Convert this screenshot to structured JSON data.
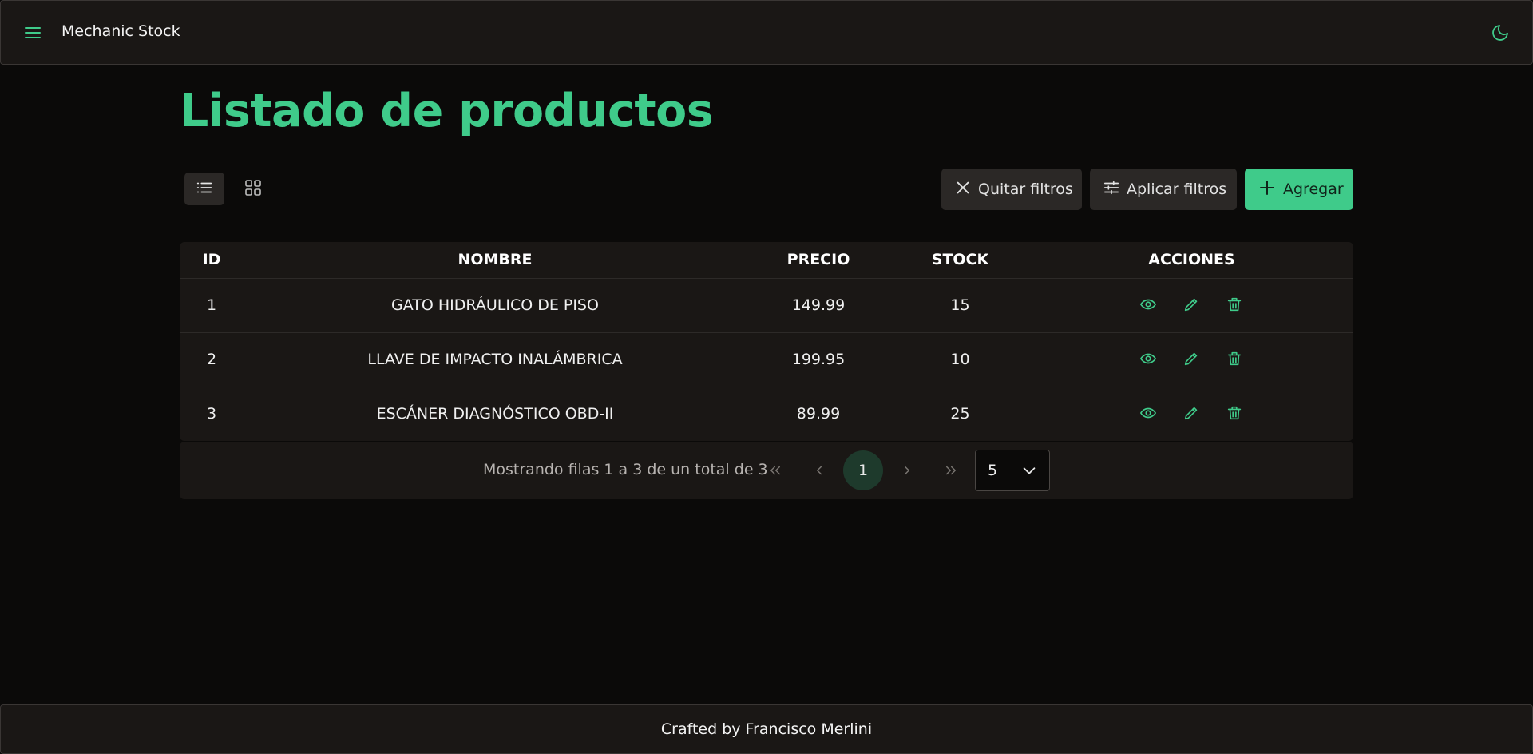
{
  "app": {
    "brand": "Mechanic Stock"
  },
  "page": {
    "title": "Listado de productos"
  },
  "toolbar": {
    "clear_label": "Quitar filtros",
    "apply_label": "Aplicar filtros",
    "add_label": "Agregar"
  },
  "table": {
    "headers": {
      "id": "ID",
      "name": "NOMBRE",
      "price": "PRECIO",
      "stock": "STOCK",
      "actions": "ACCIONES"
    },
    "rows": [
      {
        "id": "1",
        "name": "GATO HIDRÁULICO DE PISO",
        "price": "149.99",
        "stock": "15"
      },
      {
        "id": "2",
        "name": "LLAVE DE IMPACTO INALÁMBRICA",
        "price": "199.95",
        "stock": "10"
      },
      {
        "id": "3",
        "name": "ESCÁNER DIAGNÓSTICO OBD-II",
        "price": "89.99",
        "stock": "25"
      }
    ]
  },
  "pagination": {
    "info": "Mostrando filas 1 a 3 de un total de 3",
    "current_page": "1",
    "rows_per_page": "5"
  },
  "footer": {
    "text": "Crafted by Francisco Merlini"
  },
  "colors": {
    "accent": "#3fcb8a",
    "background": "#0b0a09",
    "surface": "#1a1715"
  },
  "icons": [
    "menu-icon",
    "moon-icon",
    "list-view-icon",
    "grid-view-icon",
    "close-icon",
    "sliders-icon",
    "plus-icon",
    "eye-icon",
    "pencil-icon",
    "trash-icon",
    "double-chevron-left-icon",
    "chevron-left-icon",
    "chevron-right-icon",
    "double-chevron-right-icon",
    "chevron-down-icon"
  ]
}
